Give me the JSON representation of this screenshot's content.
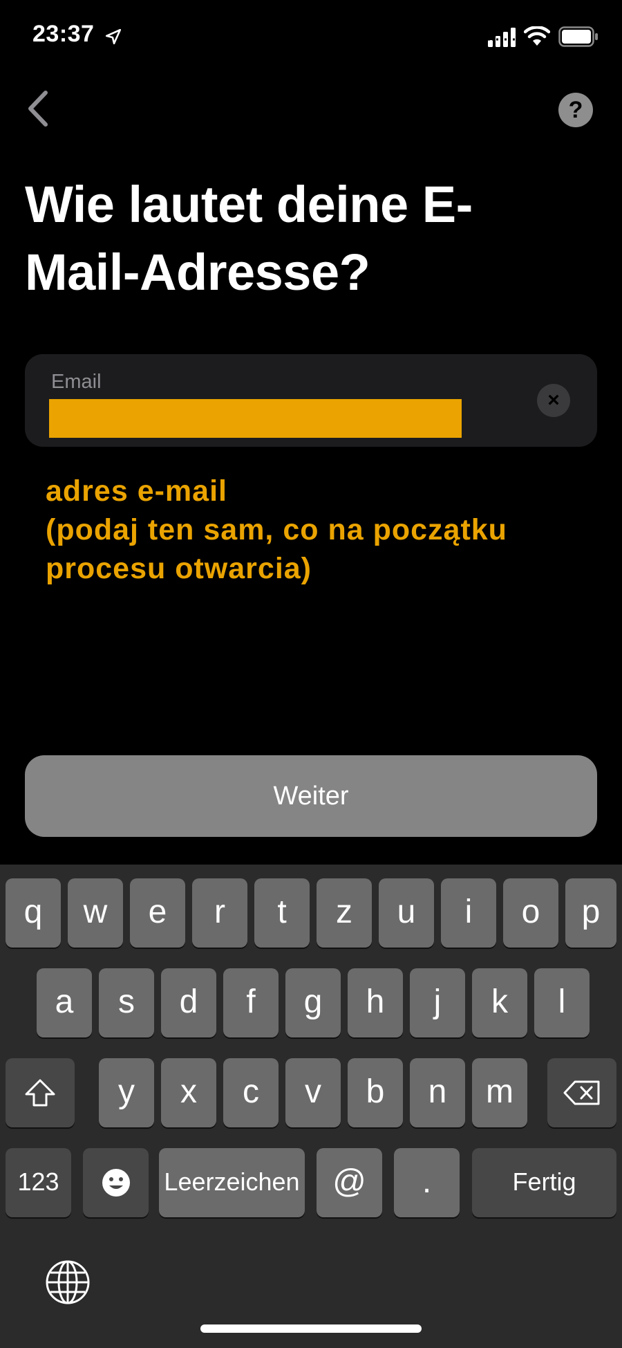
{
  "status_bar": {
    "time": "23:37"
  },
  "nav": {
    "help_label": "?"
  },
  "title": "Wie lautet deine E-\nMail-Adresse?",
  "email_field": {
    "label": "Email",
    "value": "",
    "clear_label": "×"
  },
  "annotation": "adres e-mail\n(podaj ten sam, co na początku\nprocesu otwarcia)",
  "next_button": "Weiter",
  "keyboard": {
    "row1": [
      "q",
      "w",
      "e",
      "r",
      "t",
      "z",
      "u",
      "i",
      "o",
      "p"
    ],
    "row2": [
      "a",
      "s",
      "d",
      "f",
      "g",
      "h",
      "j",
      "k",
      "l"
    ],
    "row3": [
      "y",
      "x",
      "c",
      "v",
      "b",
      "n",
      "m"
    ],
    "numbers_key": "123",
    "space_key": "Leerzeichen",
    "at_key": "@",
    "dot_key": ".",
    "done_key": "Fertig"
  },
  "colors": {
    "accent": "#eaa300",
    "background": "#000000",
    "button": "#858585"
  }
}
